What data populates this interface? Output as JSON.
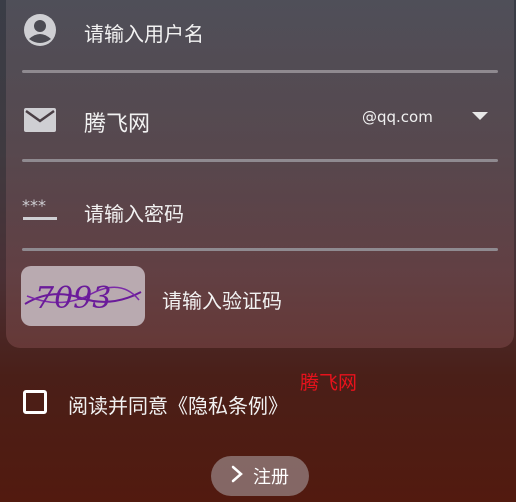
{
  "form": {
    "username": {
      "placeholder": "请输入用户名",
      "icon": "account-circle-icon"
    },
    "email": {
      "value": "腾飞网",
      "domain": "@qq.com",
      "icon": "mail-icon"
    },
    "password": {
      "placeholder": "请输入密码",
      "icon": "password-icon"
    },
    "captcha": {
      "image_text": "7093",
      "placeholder": "请输入验证码"
    }
  },
  "agreement": {
    "text": "阅读并同意《隐私条例》",
    "checked": false
  },
  "watermark": "腾飞网",
  "register": {
    "label": "注册",
    "icon": "chevron-right-icon"
  },
  "colors": {
    "watermark": "#e8121c",
    "captcha_ink": "#6a1b9a"
  }
}
